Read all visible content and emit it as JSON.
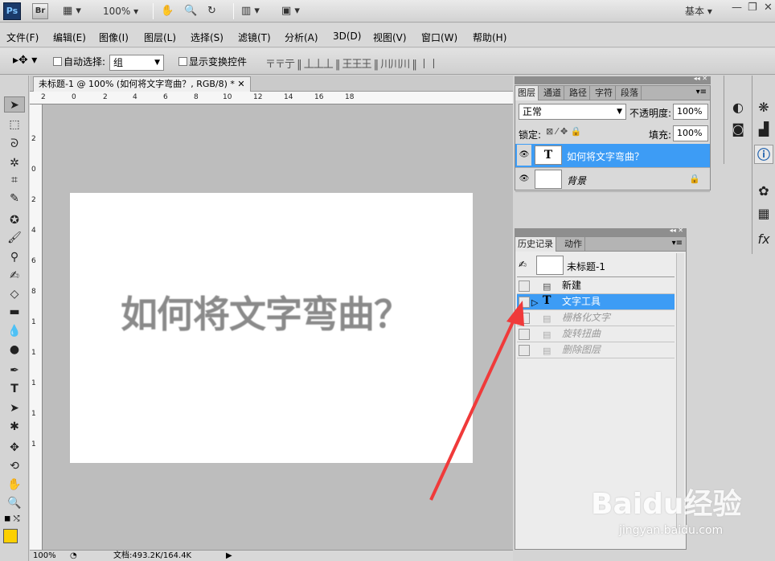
{
  "appbar": {
    "ps_label": "Ps",
    "br_label": "Br",
    "zoom": "100%",
    "workspace": "基本",
    "icons": [
      "hand-icon",
      "zoom-icon",
      "rotate-icon",
      "arrange-icon",
      "screen-mode-icon"
    ]
  },
  "menubar": [
    "文件(F)",
    "编辑(E)",
    "图像(I)",
    "图层(L)",
    "选择(S)",
    "滤镜(T)",
    "分析(A)",
    "3D(D)",
    "视图(V)",
    "窗口(W)",
    "帮助(H)"
  ],
  "options": {
    "auto_select_label": "自动选择:",
    "auto_select_value": "组",
    "show_transform_label": "显示变换控件",
    "align_icons": "〒〒亍 ‖ 丄丄丄 ‖ 王王王 ‖ 川川川 ‖ 丨丨"
  },
  "document": {
    "tab_title": "未标题-1 @ 100% (如何将文字弯曲？, RGB/8) *",
    "canvas_text": "如何将文字弯曲？",
    "ruler_top": [
      "2",
      "0",
      "2",
      "4",
      "6",
      "8",
      "10",
      "12",
      "14",
      "16",
      "18"
    ],
    "ruler_left": [
      "2",
      "0",
      "2",
      "4",
      "6",
      "8",
      "1",
      "1",
      "1",
      "1",
      "1"
    ],
    "status_zoom": "100%",
    "status_doc": "文档:493.2K/164.4K"
  },
  "layers": {
    "tabs": [
      "图层",
      "通道",
      "路径",
      "字符",
      "段落"
    ],
    "blend_mode": "正常",
    "opacity_label": "不透明度:",
    "opacity_value": "100%",
    "lock_label": "锁定:",
    "fill_label": "填充:",
    "fill_value": "100%",
    "items": [
      {
        "name": "如何将文字弯曲？",
        "type": "T",
        "selected": true
      },
      {
        "name": "背景",
        "type": "image",
        "selected": false
      }
    ]
  },
  "history": {
    "tabs": [
      "历史记录",
      "动作"
    ],
    "snapshot": "未标题-1",
    "items": [
      {
        "label": "新建",
        "active": true
      },
      {
        "label": "文字工具",
        "active": true,
        "selected": true
      },
      {
        "label": "栅格化文字",
        "active": false
      },
      {
        "label": "旋转扭曲",
        "active": false
      },
      {
        "label": "删除图层",
        "active": false
      }
    ]
  },
  "watermark": {
    "brand": "Baidu经验",
    "url": "jingyan.baidu.com"
  },
  "colors": {
    "selection": "#3d9cf5",
    "fg_color": "#fcd000",
    "arrow": "#f03a3a",
    "canvas_bg": "#bdbdbd"
  }
}
